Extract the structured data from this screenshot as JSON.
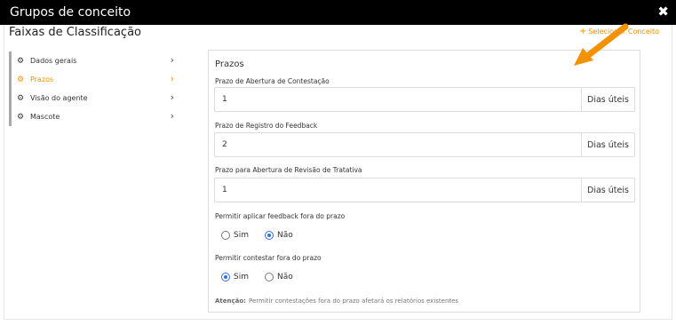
{
  "window": {
    "title": "Grupos de conceito",
    "close_icon": "close-icon"
  },
  "header": {
    "page_title": "Faixas de Classificação",
    "select_concept": "Selecionar Conceito",
    "accent_color": "#f39200"
  },
  "sidebar": {
    "items": [
      {
        "label": "Dados gerais",
        "active": false
      },
      {
        "label": "Prazos",
        "active": true
      },
      {
        "label": "Visão do agente",
        "active": false
      },
      {
        "label": "Mascote",
        "active": false
      }
    ]
  },
  "panel": {
    "title": "Prazos",
    "fields": [
      {
        "label": "Prazo de Abertura de Contestação",
        "value": "1",
        "unit": "Dias úteis"
      },
      {
        "label": "Prazo de Registro do Feedback",
        "value": "2",
        "unit": "Dias úteis"
      },
      {
        "label": "Prazo para Abertura de Revisão de Tratativa",
        "value": "1",
        "unit": "Dias úteis"
      }
    ],
    "allow_feedback": {
      "label": "Permitir aplicar feedback fora do prazo",
      "yes": "Sim",
      "no": "Não",
      "selected": "Não"
    },
    "allow_contest": {
      "label": "Permitir contestar fora do prazo",
      "yes": "Sim",
      "no": "Não",
      "selected": "Sim"
    },
    "note_label": "Atenção:",
    "note_text": "Permitir contestações fora do prazo afetará os relatórios existentes"
  },
  "annotation": {
    "arrow_color": "#f39200"
  },
  "colors": {
    "radio_checked": "#2f6fde",
    "titlebar": "#000000"
  }
}
